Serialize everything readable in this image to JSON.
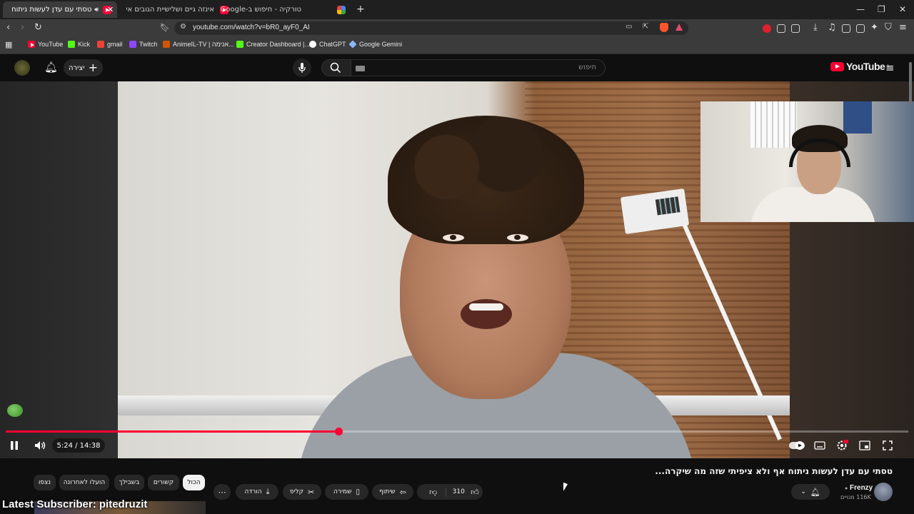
{
  "browser": {
    "tabs": [
      {
        "title": "טסתי עם עדן לעשות ניתוח אף",
        "favicon": "youtube",
        "active": true
      },
      {
        "title": "אינזה גיים ושלישיית הגובים איבדו את",
        "favicon": "youtube",
        "active": false
      },
      {
        "title": "טורקיה - חיפוש ב-Google",
        "favicon": "google",
        "active": false
      }
    ],
    "new_tab": "+",
    "url": "youtube.com/watch?v=bR0_ayF0_AI",
    "bookmarks": [
      {
        "label": "YouTube",
        "icon": "youtube-icon",
        "color": "#ff0033"
      },
      {
        "label": "Kick",
        "icon": "kick-icon",
        "color": "#53fc18"
      },
      {
        "label": "gmail",
        "icon": "gmail-icon",
        "color": "#ea4335"
      },
      {
        "label": "Twitch",
        "icon": "twitch-icon",
        "color": "#9146ff"
      },
      {
        "label": "AnimeIL-TV | אנימה...",
        "icon": "animeil-icon",
        "color": "#d35400"
      },
      {
        "label": "Creator Dashboard |...",
        "icon": "kick-creator-icon",
        "color": "#53fc18"
      },
      {
        "label": "ChatGPT",
        "icon": "chatgpt-icon",
        "color": "#ffffff"
      },
      {
        "label": "Google Gemini",
        "icon": "gemini-icon",
        "color": "#8ab4f8"
      }
    ]
  },
  "header": {
    "logo": "YouTube",
    "logo_superscript": "IL",
    "search_placeholder": "חיפוש",
    "create_label": "יצירה"
  },
  "player": {
    "time_current": "5:24",
    "time_total": "14:38",
    "time_display": "5:24 / 14:38",
    "progress": 0.369,
    "state": "playing"
  },
  "video": {
    "title": "טסתי עם עדן לעשות ניתוח אף ולא ציפיתי שזה מה שיקרה...",
    "channel": "Frenzy",
    "subscribers": "116K מנויים",
    "likes": "310",
    "actions": {
      "share": "שיתוף",
      "save": "שמירה",
      "clip": "קליפ",
      "download": "הורדה"
    }
  },
  "chips": [
    {
      "label": "הכול",
      "selected": true
    },
    {
      "label": "קשורים",
      "selected": false
    },
    {
      "label": "בשבילך",
      "selected": false
    },
    {
      "label": "הועלו לאחרונה",
      "selected": false
    },
    {
      "label": "נצפו",
      "selected": false
    }
  ],
  "overlay": {
    "latest_subscriber": "Latest Subscriber: pitedruzit"
  },
  "colors": {
    "accent": "#ff0033",
    "background": "#0f0f0f",
    "pill": "#272727"
  }
}
